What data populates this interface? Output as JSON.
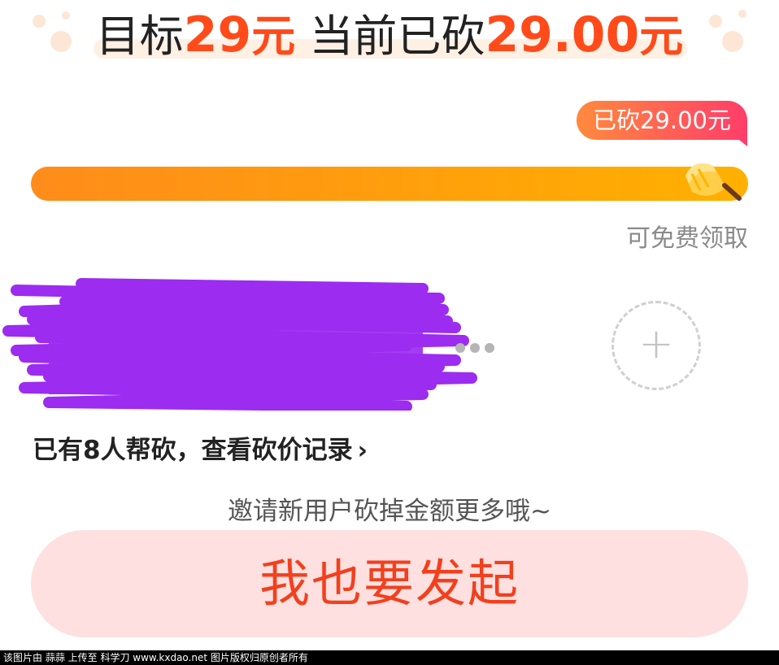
{
  "header": {
    "target_label": "目标",
    "target_amount": "29",
    "target_unit": "元",
    "current_label": "当前已砍",
    "current_amount": "29.00",
    "current_unit": "元"
  },
  "progress": {
    "badge_text": "已砍29.00元",
    "fraction": 1.0,
    "status_text": "可免费领取"
  },
  "helpers": {
    "link_text": "已有8人帮砍，查看砍价记录",
    "chevron": "›",
    "add_icon": "+"
  },
  "invite": {
    "tip": "邀请新用户砍掉金额更多哦~",
    "cta_label": "我也要发起"
  },
  "watermark": {
    "text": "该图片由 蒜蒜 上传至 科学刀 www.kxdao.net 图片版权归原创者所有"
  },
  "colors": {
    "accent": "#ff4a1a",
    "progress_start": "#ff8c1a",
    "progress_end": "#ffb000",
    "badge_start": "#ff8a3d",
    "badge_end": "#ff3d6a",
    "cta_bg": "#fde0df",
    "cta_text": "#f2401e",
    "redaction": "#9b2cf0"
  }
}
